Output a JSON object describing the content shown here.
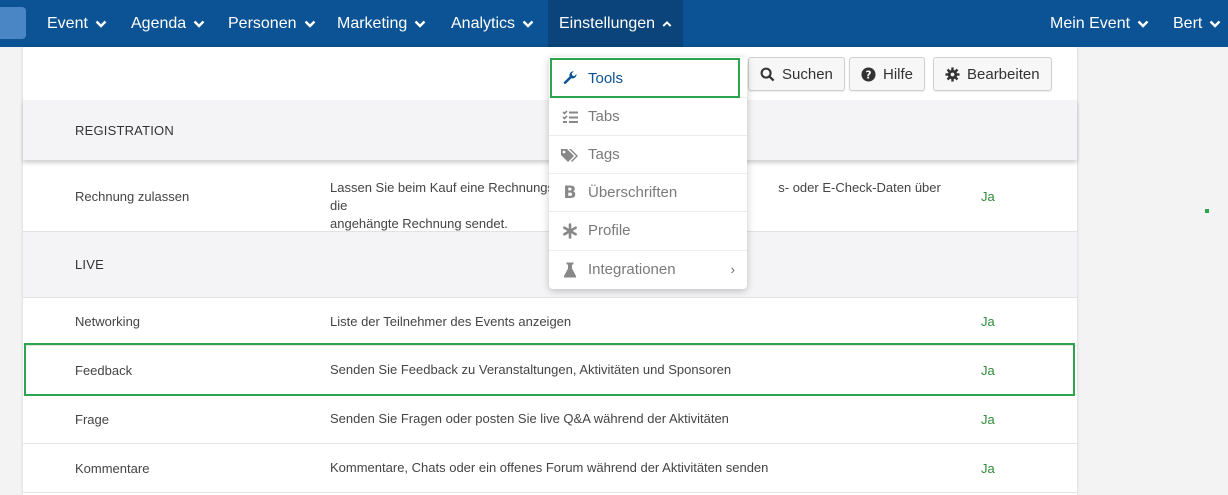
{
  "nav": {
    "items": [
      "Event",
      "Agenda",
      "Personen",
      "Marketing",
      "Analytics",
      "Einstellungen"
    ],
    "right": [
      "Mein Event",
      "Bert"
    ]
  },
  "toolbar": {
    "search_label": "Suchen",
    "help_label": "Hilfe",
    "edit_label": "Bearbeiten"
  },
  "dropdown": {
    "items": [
      {
        "label": "Tools",
        "icon": "wrench-icon"
      },
      {
        "label": "Tabs",
        "icon": "list-check-icon"
      },
      {
        "label": "Tags",
        "icon": "tags-icon"
      },
      {
        "label": "Überschriften",
        "icon": "bold-icon"
      },
      {
        "label": "Profile",
        "icon": "asterisk-icon"
      },
      {
        "label": "Integrationen",
        "icon": "flask-icon"
      }
    ]
  },
  "sections": {
    "registration": "REGISTRATION",
    "live": "LIVE"
  },
  "rows": [
    {
      "name": "Rechnung zulassen",
      "desc": "Lassen Sie beim Kauf eine Rechnungse",
      "desc2": "s- oder E-Check-Daten über die",
      "desc3": "angehängte Rechnung sendet.",
      "value": "Ja"
    },
    {
      "name": "Networking",
      "desc": "Liste der Teilnehmer des Events anzeigen",
      "value": "Ja"
    },
    {
      "name": "Feedback",
      "desc": "Senden Sie Feedback zu Veranstaltungen, Aktivitäten und Sponsoren",
      "value": "Ja"
    },
    {
      "name": "Frage",
      "desc": "Senden Sie Fragen oder posten Sie live Q&A während der Aktivitäten",
      "value": "Ja"
    },
    {
      "name": "Kommentare",
      "desc": "Kommentare, Chats oder ein offenes Forum während der Aktivitäten senden",
      "value": "Ja"
    }
  ],
  "colors": {
    "nav_bg": "#0b5394",
    "highlight": "#2ea44f",
    "value_green": "#2e8b3a"
  }
}
